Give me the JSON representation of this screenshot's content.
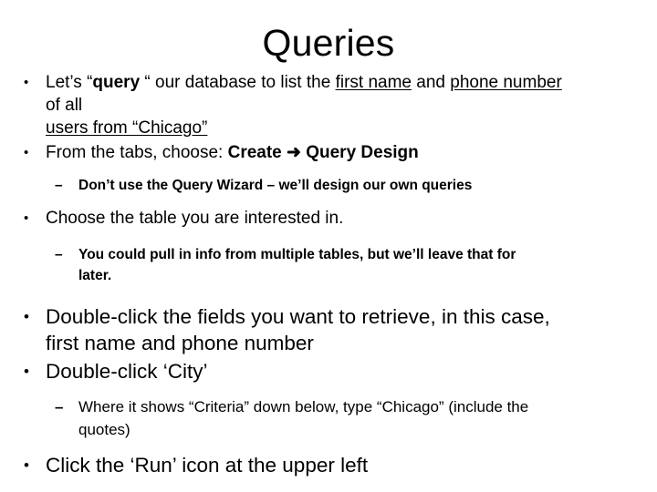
{
  "slide": {
    "title": "Queries",
    "background_color": "#ffffff",
    "text_color": "#000000",
    "bullet_marker": "•",
    "dash_marker": "–",
    "arrow_glyph": "➜"
  },
  "content": {
    "b1_line1_a": "Let’s “",
    "b1_query": "query",
    "b1_line1_b": " “ our database to list the ",
    "b1_first_name": "first name",
    "b1_line1_c": " and ",
    "b1_phone_number": "phone number",
    "b1_line1_d": " of all",
    "b1_line2": "users from “Chicago”",
    "b2_prefix": "From the tabs, choose:  ",
    "b2_create": "Create",
    "b2_arrow": "➜",
    "b2_query_design": "Query Design",
    "b3": "Don’t use the Query Wizard – we’ll design our own queries",
    "b4": "Choose the table you are interested in.",
    "b5": "You could pull in info from multiple tables, but we’ll leave that for later.",
    "b6": "Double-click the fields you want to retrieve, in this case, first name and phone number",
    "b7": "Double-click  ‘City’",
    "b8": "Where it shows “Criteria” down below, type “Chicago” (include the quotes)",
    "b9": "Click the ‘Run’ icon at the upper left"
  }
}
